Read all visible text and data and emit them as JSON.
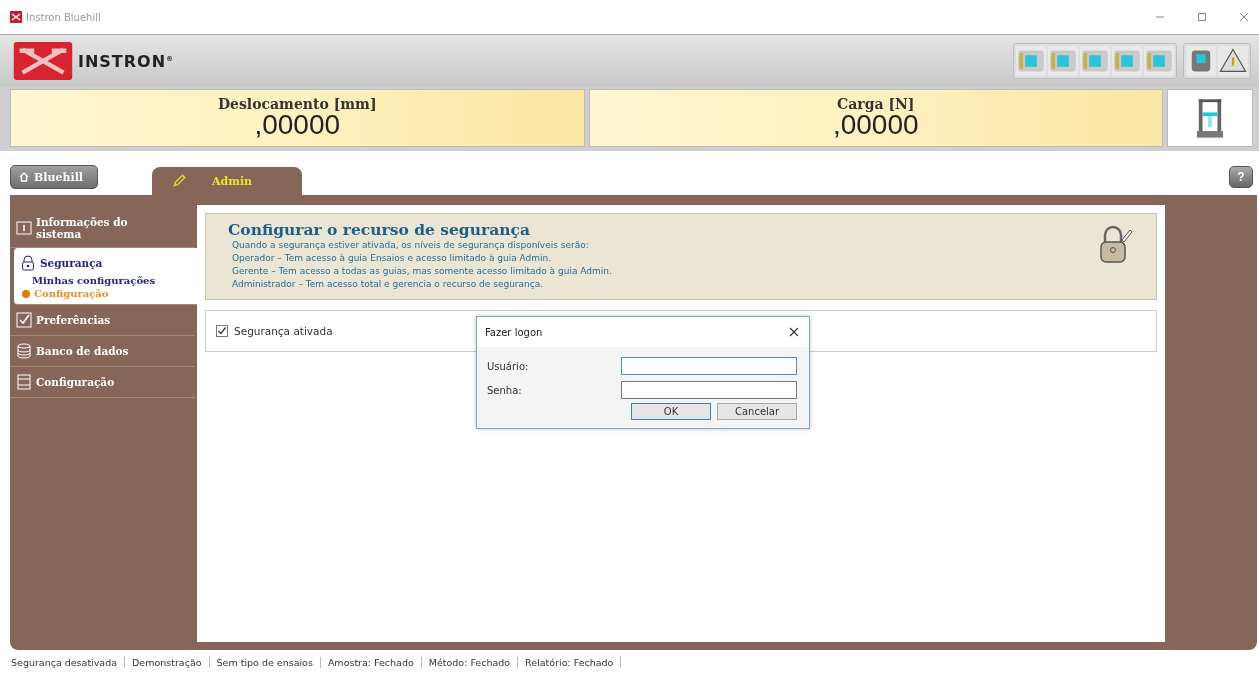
{
  "window": {
    "title": "Instron Bluehill"
  },
  "brand": {
    "name": "INSTRON",
    "mark": "®"
  },
  "readouts": [
    {
      "label": "Deslocamento [mm]",
      "value": ",00000"
    },
    {
      "label": "Carga [N]",
      "value": ",00000"
    }
  ],
  "home_button": {
    "label": "Bluehill"
  },
  "tabs": [
    {
      "label": "Admin",
      "selected": true
    }
  ],
  "help_button": {
    "label": "?"
  },
  "sidebar": {
    "items": [
      {
        "label": "Informações do sistema",
        "selected": false
      },
      {
        "label": "Segurança",
        "selected": true,
        "children": [
          {
            "label": "Minhas configurações",
            "selected": false
          },
          {
            "label": "Configuração",
            "selected": true
          }
        ]
      },
      {
        "label": "Preferências",
        "selected": false
      },
      {
        "label": "Banco de dados",
        "selected": false
      },
      {
        "label": "Configuração",
        "selected": false
      }
    ]
  },
  "section": {
    "title": "Configurar o recurso de segurança",
    "lines": [
      "Quando a segurança estiver ativada, os níveis de segurança disponíveis serão:",
      "Operador – Tem acesso à guia Ensaios e acesso limitado à guia Admin.",
      "Gerente – Tem acesso a todas as guias, mas somente acesso limitado à guia Admin.",
      "Administrador – Tem acesso total e gerencia o recurso de segurança."
    ]
  },
  "security_checkbox": {
    "label": "Segurança ativada",
    "checked": true
  },
  "dialog": {
    "title": "Fazer logon",
    "fields": [
      {
        "label": "Usuário:",
        "focused": true
      },
      {
        "label": "Senha:",
        "focused": false
      }
    ],
    "buttons": [
      {
        "label": "OK",
        "default": true
      },
      {
        "label": "Cancelar",
        "default": false
      }
    ]
  },
  "status_bar": [
    "Segurança desativada",
    "Demonstração",
    "Sem tipo de ensaios",
    "Amostra: Fechado",
    "Método: Fechado",
    "Relatório: Fechado"
  ]
}
